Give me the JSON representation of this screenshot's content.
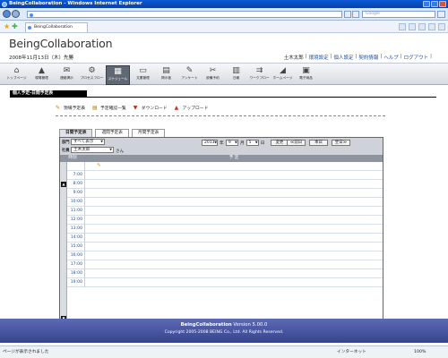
{
  "browser": {
    "window_title": "BeingCollaboration - Windows Internet Explorer",
    "address_url": "",
    "search_placeholder": "Google",
    "tab_title": "BeingCollaboration"
  },
  "header": {
    "logo": "BeingCollaboration",
    "date": "2008年11月13日（木）先勝",
    "user": "土木太郎",
    "links": [
      "環境設定",
      "個人設定",
      "契約情報",
      "ヘルプ",
      "ログアウト"
    ],
    "separator": "|"
  },
  "toolbar": {
    "items": [
      {
        "label": "トップページ",
        "icon": "home-icon"
      },
      {
        "label": "現場管理",
        "icon": "site-icon"
      },
      {
        "label": "連絡掲示",
        "icon": "board-icon"
      },
      {
        "label": "プロセスフロー",
        "icon": "process-icon"
      },
      {
        "label": "スケジュール",
        "icon": "calendar-icon",
        "active": true
      },
      {
        "label": "文書管理",
        "icon": "folder-icon"
      },
      {
        "label": "掲示板",
        "icon": "bbs-icon"
      },
      {
        "label": "アンケート",
        "icon": "survey-icon"
      },
      {
        "label": "設備予約",
        "icon": "equipment-icon"
      },
      {
        "label": "日報",
        "icon": "report-icon"
      },
      {
        "label": "ワークフロー",
        "icon": "workflow-icon"
      },
      {
        "label": "ホームページ",
        "icon": "homepage-icon"
      },
      {
        "label": "電子納品",
        "icon": "delivery-icon"
      }
    ]
  },
  "section": {
    "title": "個人予定-日間予定表"
  },
  "actions": [
    {
      "label": "現場予定表",
      "icon": "site-schedule-icon"
    },
    {
      "label": "予定確認一覧",
      "icon": "list-icon"
    },
    {
      "label": "ダウンロード",
      "icon": "download-icon"
    },
    {
      "label": "アップロード",
      "icon": "upload-icon"
    }
  ],
  "tabs": [
    {
      "label": "日間予定表",
      "active": true
    },
    {
      "label": "週間予定表",
      "active": false
    },
    {
      "label": "月間予定表",
      "active": false
    }
  ],
  "filters": {
    "dept_label": "部門",
    "dept_value": "すべて表示",
    "staff_label": "社員",
    "staff_value": "土木太郎",
    "staff_suffix": "さん"
  },
  "date_ctrl": {
    "year": "2013",
    "year_unit": "年",
    "month": "9",
    "month_unit": "月",
    "day": "5",
    "day_unit": "日",
    "change_btn": "変更",
    "prev_btn": "≪前日",
    "today_btn": "本日",
    "next_btn": "翌日≫"
  },
  "grid": {
    "col_time": "時刻",
    "col_plan": "予 定",
    "hours": [
      "",
      "7:00",
      "8:00",
      "9:00",
      "10:00",
      "11:00",
      "12:00",
      "13:00",
      "14:00",
      "15:00",
      "16:00",
      "17:00",
      "18:00",
      "19:00"
    ]
  },
  "page_top": "このページのトップへ",
  "footer": {
    "product": "BeingCollaboration",
    "version": "Version 5.00.0",
    "copyright": "Copyright 2005-2008 BEING Co., Ltd. All Rights Reserved."
  },
  "status": {
    "text": "ページが表示されました",
    "zone": "インターネット",
    "zoom": "100%"
  }
}
